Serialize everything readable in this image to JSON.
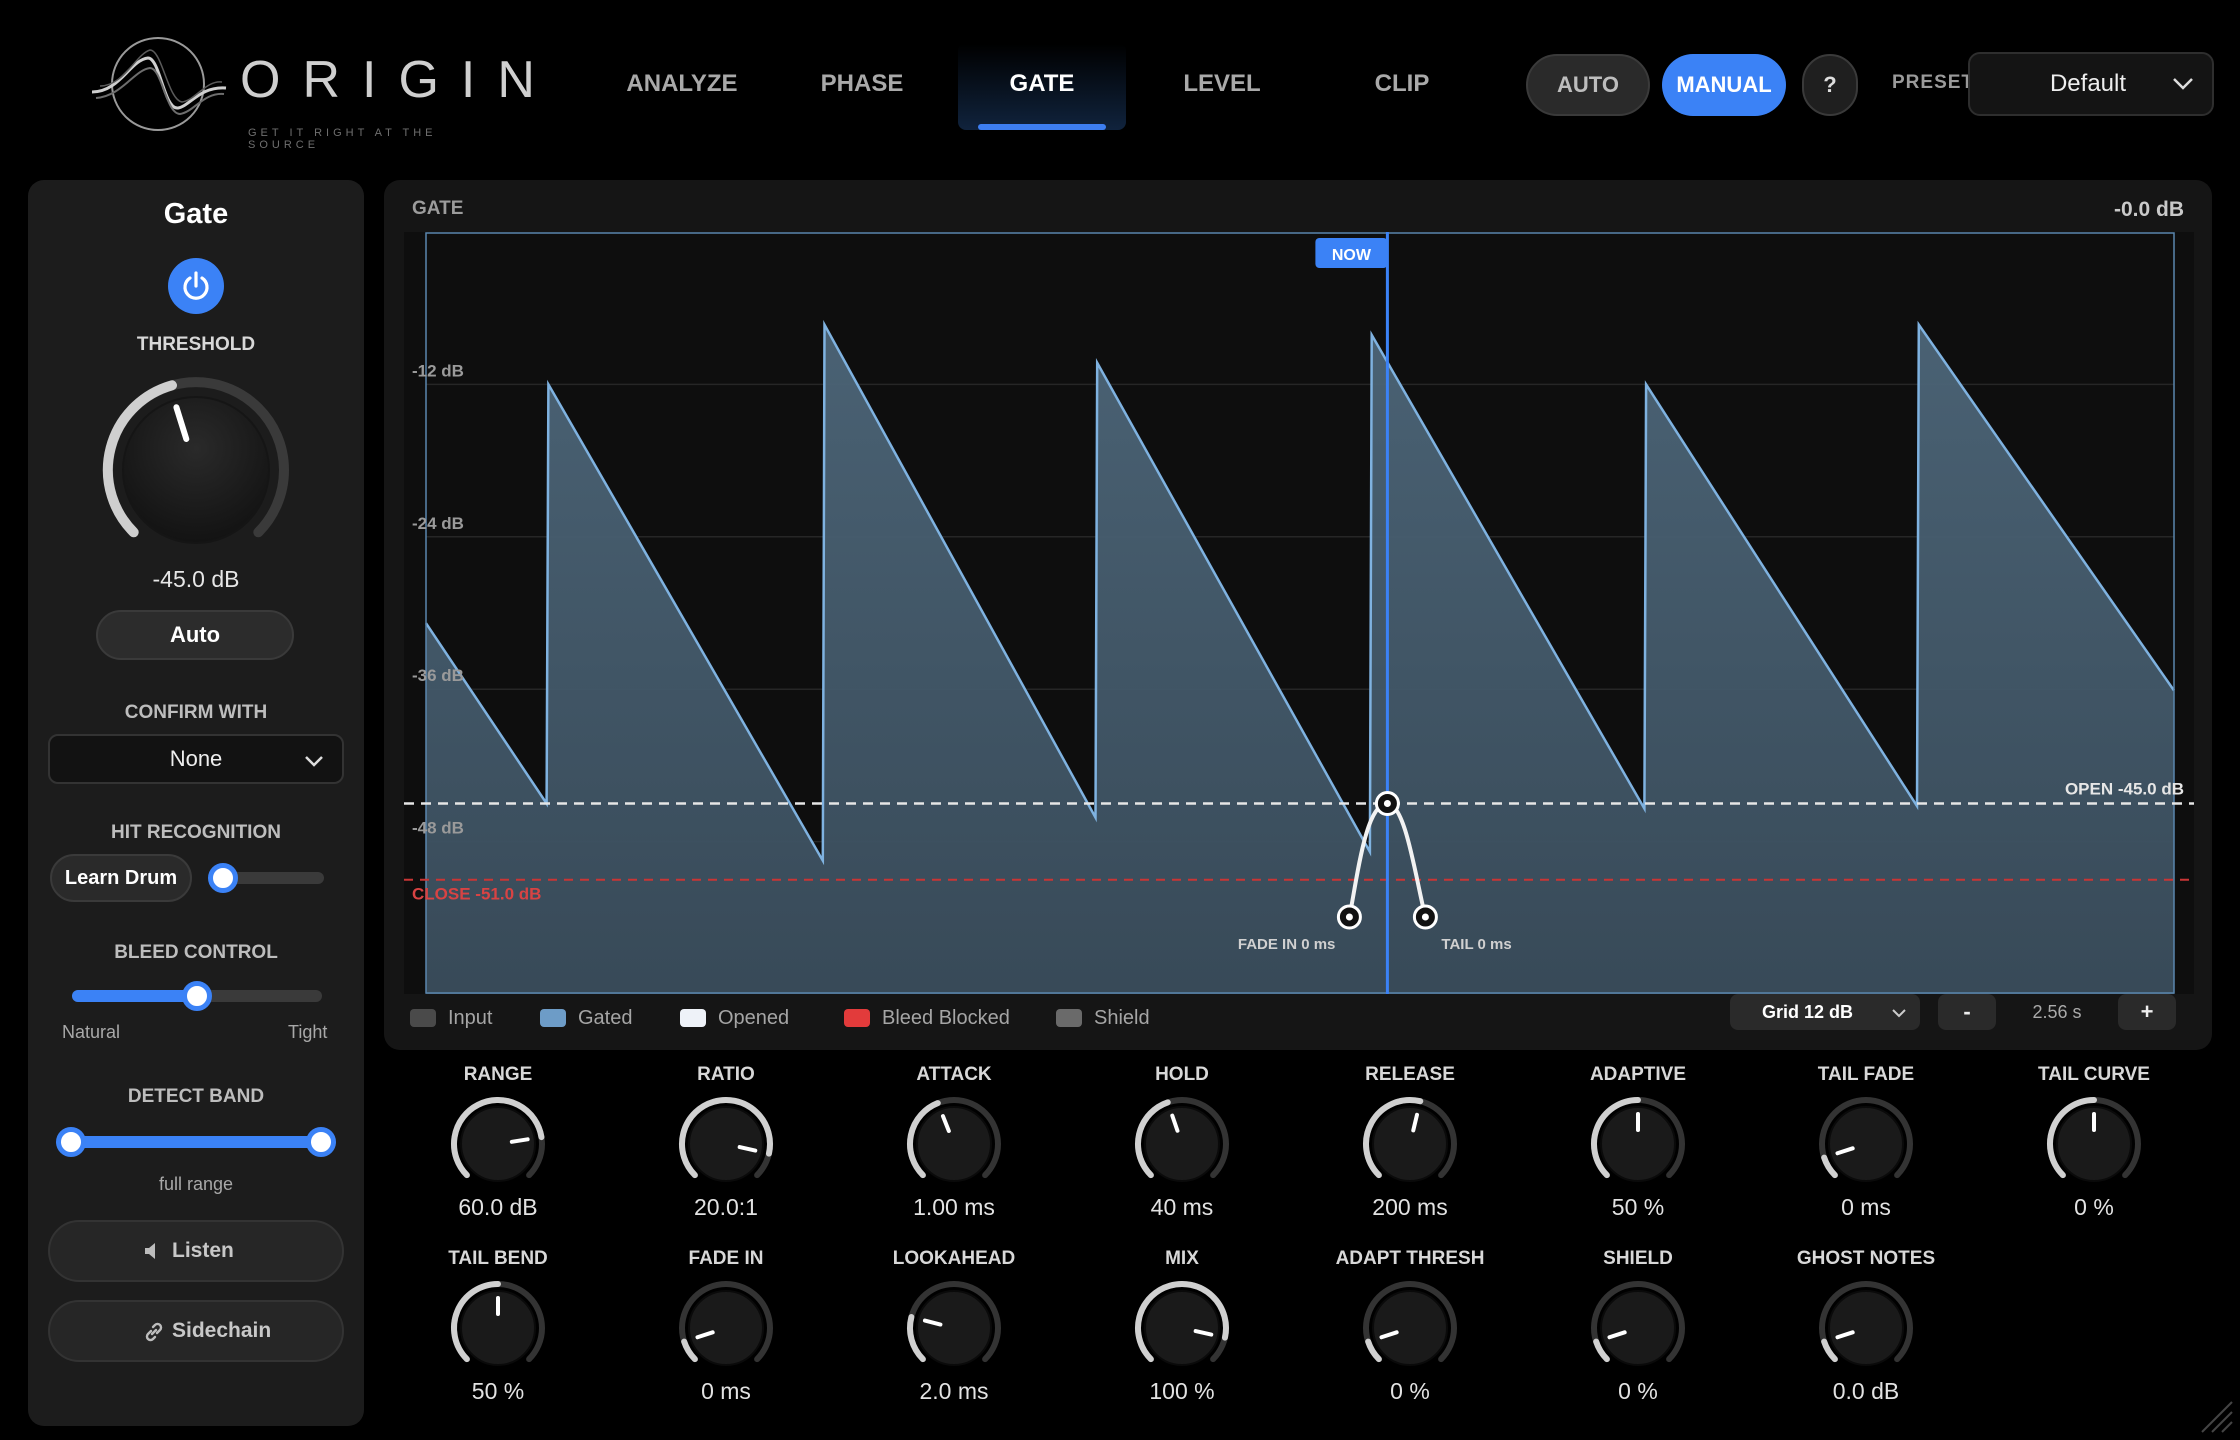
{
  "app": {
    "name": "ORIGIN",
    "tagline": "GET IT RIGHT AT THE SOURCE"
  },
  "nav": {
    "tabs": [
      {
        "label": "ANALYZE",
        "active": false
      },
      {
        "label": "PHASE",
        "active": false
      },
      {
        "label": "GATE",
        "active": true
      },
      {
        "label": "LEVEL",
        "active": false
      },
      {
        "label": "CLIP",
        "active": false
      }
    ],
    "mode_auto": "AUTO",
    "mode_manual": "MANUAL",
    "mode_selected": "MANUAL",
    "help": "?",
    "preset_label": "PRESET",
    "preset_value": "Default"
  },
  "left_panel": {
    "title": "Gate",
    "power_on": true,
    "threshold_label": "THRESHOLD",
    "threshold_value": "-45.0 dB",
    "auto_button": "Auto",
    "confirm_label": "CONFIRM WITH",
    "confirm_value": "None",
    "hit_label": "HIT RECOGNITION",
    "learn_button": "Learn Drum",
    "hit_slider": 0.0,
    "bleed_label": "BLEED CONTROL",
    "bleed_value": 0.5,
    "bleed_min_label": "Natural",
    "bleed_max_label": "Tight",
    "detect_label": "DETECT BAND",
    "detect_low": 0.0,
    "detect_high": 1.0,
    "detect_text": "full range",
    "listen_button": "Listen",
    "sidechain_button": "Sidechain"
  },
  "graph": {
    "title": "GATE",
    "peak_readout": "-0.0 dB",
    "now_label": "NOW",
    "open_label": "OPEN -45.0 dB",
    "close_label": "CLOSE -51.0 dB",
    "fade_in_label": "FADE IN 0 ms",
    "tail_label": "TAIL 0 ms",
    "db_labels": [
      "-12 dB",
      "-24 dB",
      "-36 dB",
      "-48 dB"
    ],
    "grid_setting": "Grid 12 dB",
    "zoom_minus": "-",
    "zoom_plus": "+",
    "time_span": "2.56 s",
    "legend": [
      {
        "label": "Input",
        "color": "#4a4a4a"
      },
      {
        "label": "Gated",
        "color": "#6d9cc7"
      },
      {
        "label": "Opened",
        "color": "#eef2f8"
      },
      {
        "label": "Bleed Blocked",
        "color": "#e23b3b"
      },
      {
        "label": "Shield",
        "color": "#6a6a6a"
      }
    ]
  },
  "chart_data": {
    "type": "area",
    "title": "GATE",
    "xlabel": "",
    "ylabel": "",
    "x_span": "2.56 s",
    "ylim": [
      -60,
      0
    ],
    "y_ticks": [
      -12,
      -24,
      -36,
      -48
    ],
    "open_threshold_db": -45.0,
    "close_threshold_db": -51.0,
    "series": [
      {
        "name": "Gated",
        "color": "#6d9cc7",
        "x": [
          0.0,
          0.069,
          0.07,
          0.227,
          0.228,
          0.383,
          0.384,
          0.54,
          0.541,
          0.697,
          0.698,
          0.853,
          0.854,
          1.0
        ],
        "values": [
          -30.8,
          -45.0,
          -12.0,
          -49.5,
          -7.3,
          -46.1,
          -10.3,
          -48.8,
          -8.1,
          -45.4,
          -12.0,
          -45.2,
          -7.3,
          -36.1
        ]
      }
    ],
    "now_position": 0.55,
    "open_marker_db": -45.0
  },
  "knobs_row1": [
    {
      "label": "RANGE",
      "value": "60.0 dB",
      "pos": 0.8
    },
    {
      "label": "RATIO",
      "value": "20.0:1",
      "pos": 0.88
    },
    {
      "label": "ATTACK",
      "value": "1.00 ms",
      "pos": 0.42
    },
    {
      "label": "HOLD",
      "value": "40 ms",
      "pos": 0.43
    },
    {
      "label": "RELEASE",
      "value": "200 ms",
      "pos": 0.55
    },
    {
      "label": "ADAPTIVE",
      "value": "50 %",
      "pos": 0.5
    },
    {
      "label": "TAIL FADE",
      "value": "0 ms",
      "pos": 0.1
    },
    {
      "label": "TAIL CURVE",
      "value": "0 %",
      "pos": 0.5
    }
  ],
  "knobs_row2": [
    {
      "label": "TAIL BEND",
      "value": "50 %",
      "pos": 0.5
    },
    {
      "label": "FADE IN",
      "value": "0 ms",
      "pos": 0.1
    },
    {
      "label": "LOOKAHEAD",
      "value": "2.0 ms",
      "pos": 0.22
    },
    {
      "label": "MIX",
      "value": "100 %",
      "pos": 0.88
    },
    {
      "label": "ADAPT THRESH",
      "value": "0 %",
      "pos": 0.1
    },
    {
      "label": "SHIELD",
      "value": "0 %",
      "pos": 0.1
    },
    {
      "label": "GHOST NOTES",
      "value": "0.0 dB",
      "pos": 0.1
    }
  ],
  "colors": {
    "accent": "#3b82f6",
    "background": "#000000",
    "panel": "#1c1c1c",
    "close_line": "#e23b3b"
  }
}
